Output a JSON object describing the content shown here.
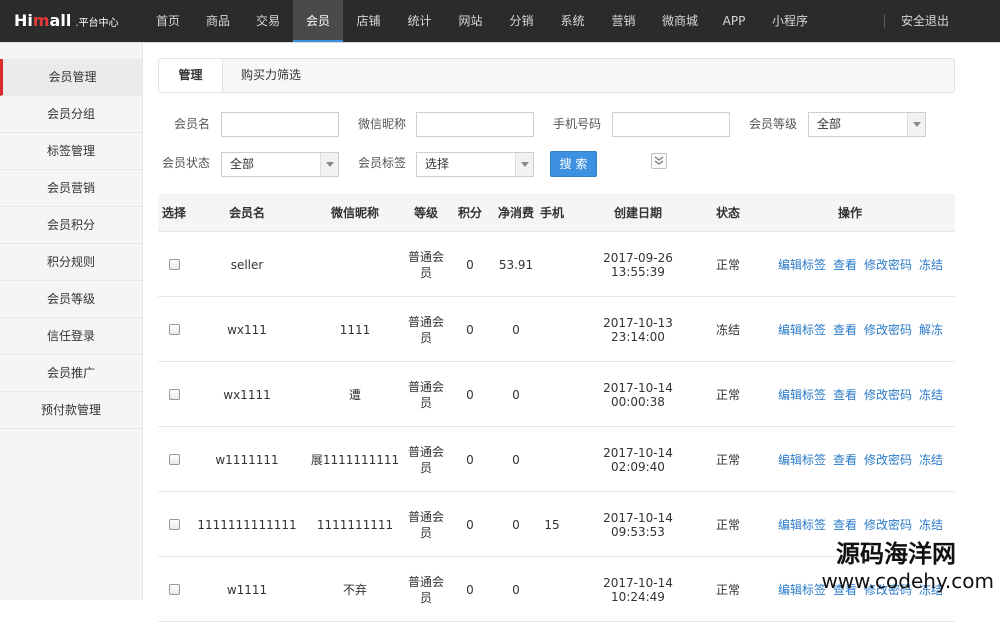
{
  "app": {
    "logo_main_prefix": "Hi",
    "logo_main_m": "m",
    "logo_main_suffix": "all",
    "logo_sub": ".平台中心"
  },
  "nav": {
    "items": [
      "首页",
      "商品",
      "交易",
      "会员",
      "店铺",
      "统计",
      "网站",
      "分销",
      "系统",
      "营销",
      "微商城",
      "APP",
      "小程序"
    ],
    "active": "会员",
    "logout": "安全退出"
  },
  "sidebar": {
    "items": [
      "会员管理",
      "会员分组",
      "标签管理",
      "会员营销",
      "会员积分",
      "积分规则",
      "会员等级",
      "信任登录",
      "会员推广",
      "预付款管理"
    ],
    "active": "会员管理"
  },
  "tabs": {
    "manage": "管理",
    "filter": "购买力筛选"
  },
  "filters": {
    "member_name_label": "会员名",
    "wechat_nick_label": "微信昵称",
    "phone_label": "手机号码",
    "level_label": "会员等级",
    "level_value": "全部",
    "status_label": "会员状态",
    "status_value": "全部",
    "tag_label": "会员标签",
    "tag_value": "选择",
    "search_button": "搜 索"
  },
  "table": {
    "headers": {
      "select": "选择",
      "name": "会员名",
      "nick": "微信昵称",
      "level": "等级",
      "points": "积分",
      "net": "净消费",
      "phone": "手机",
      "created": "创建日期",
      "status": "状态",
      "ops": "操作"
    },
    "rows": [
      {
        "name": "seller",
        "nick": "",
        "level": "普通会员",
        "points": "0",
        "net": "53.91",
        "phone": "",
        "created": "2017-09-26 13:55:39",
        "status": "正常",
        "ops": [
          "编辑标签",
          "查看",
          "修改密码",
          "冻结"
        ]
      },
      {
        "name": "wx111",
        "nick": "1111",
        "level": "普通会员",
        "points": "0",
        "net": "0",
        "phone": "",
        "created": "2017-10-13 23:14:00",
        "status": "冻结",
        "ops": [
          "编辑标签",
          "查看",
          "修改密码",
          "解冻"
        ]
      },
      {
        "name": "wx1111",
        "nick": "遭",
        "level": "普通会员",
        "points": "0",
        "net": "0",
        "phone": "",
        "created": "2017-10-14 00:00:38",
        "status": "正常",
        "ops": [
          "编辑标签",
          "查看",
          "修改密码",
          "冻结"
        ]
      },
      {
        "name": "w1111111",
        "nick": "展1111111111",
        "level": "普通会员",
        "points": "0",
        "net": "0",
        "phone": "",
        "created": "2017-10-14 02:09:40",
        "status": "正常",
        "ops": [
          "编辑标签",
          "查看",
          "修改密码",
          "冻结"
        ]
      },
      {
        "name": "1111111111111",
        "nick": "1111111111",
        "level": "普通会员",
        "points": "0",
        "net": "0",
        "phone": "15",
        "created": "2017-10-14 09:53:53",
        "status": "正常",
        "ops": [
          "编辑标签",
          "查看",
          "修改密码",
          "冻结"
        ]
      },
      {
        "name": "w1111",
        "nick": "不弃",
        "level": "普通会员",
        "points": "0",
        "net": "0",
        "phone": "",
        "created": "2017-10-14 10:24:49",
        "status": "正常",
        "ops": [
          "编辑标签",
          "查看",
          "修改密码",
          "冻结"
        ]
      }
    ]
  },
  "watermark": {
    "line1": "源码海洋网",
    "line2": "www.codehy.com"
  },
  "colors": {
    "topbar": "#2b2b2b",
    "accent_blue": "#3d91e0",
    "link_blue": "#2a7ac8",
    "sidebar_active_marker": "#d92c2c"
  }
}
